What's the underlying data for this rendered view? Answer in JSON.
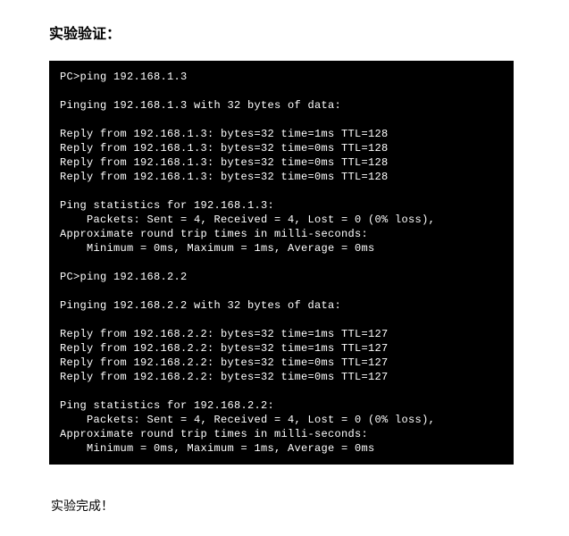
{
  "heading": "实验验证：",
  "terminal": {
    "lines": [
      "PC>ping 192.168.1.3",
      "",
      "Pinging 192.168.1.3 with 32 bytes of data:",
      "",
      "Reply from 192.168.1.3: bytes=32 time=1ms TTL=128",
      "Reply from 192.168.1.3: bytes=32 time=0ms TTL=128",
      "Reply from 192.168.1.3: bytes=32 time=0ms TTL=128",
      "Reply from 192.168.1.3: bytes=32 time=0ms TTL=128",
      "",
      "Ping statistics for 192.168.1.3:",
      "    Packets: Sent = 4, Received = 4, Lost = 0 (0% loss),",
      "Approximate round trip times in milli-seconds:",
      "    Minimum = 0ms, Maximum = 1ms, Average = 0ms",
      "",
      "PC>ping 192.168.2.2",
      "",
      "Pinging 192.168.2.2 with 32 bytes of data:",
      "",
      "Reply from 192.168.2.2: bytes=32 time=1ms TTL=127",
      "Reply from 192.168.2.2: bytes=32 time=1ms TTL=127",
      "Reply from 192.168.2.2: bytes=32 time=0ms TTL=127",
      "Reply from 192.168.2.2: bytes=32 time=0ms TTL=127",
      "",
      "Ping statistics for 192.168.2.2:",
      "    Packets: Sent = 4, Received = 4, Lost = 0 (0% loss),",
      "Approximate round trip times in milli-seconds:",
      "    Minimum = 0ms, Maximum = 1ms, Average = 0ms"
    ]
  },
  "footer": "实验完成！"
}
